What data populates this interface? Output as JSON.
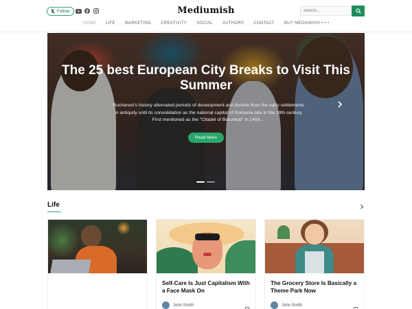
{
  "header": {
    "follow_label": "Follow",
    "follow_icon": "x-logo",
    "logo": "Mediumish",
    "search_placeholder": "Search...",
    "social_icons": [
      "youtube-icon",
      "facebook-icon",
      "instagram-icon"
    ]
  },
  "nav": {
    "items": [
      "HOME",
      "LIFE",
      "MARKETING",
      "CREATIVITY",
      "SOCIAL",
      "AUTHORS",
      "CONTACT",
      "BUY MEDIUMISH"
    ],
    "active": "HOME",
    "more_label": "• • •"
  },
  "hero": {
    "title": "The 25 best European City Breaks to Visit This Summer",
    "description": "Bucharest's history alternated periods of development and decline from the early settlements in antiquity until its consolidation as the national capital of Romania late in the 19th century. First mentioned as the \"Citadel of Bucureşti\" in 1459,...",
    "button_label": "Read More",
    "slide_count": 2,
    "active_slide": 1
  },
  "section": {
    "title": "Life"
  },
  "cards": [
    {
      "title": "",
      "author": ""
    },
    {
      "title": "Self-Care Is Just Capitalism With a Face Mask On",
      "author": "John Smith"
    },
    {
      "title": "The Grocery Store Is Basically a Theme Park Now",
      "author": "John Smith"
    }
  ],
  "colors": {
    "accent": "#2aa66b",
    "search_button": "#1f8e5c"
  }
}
